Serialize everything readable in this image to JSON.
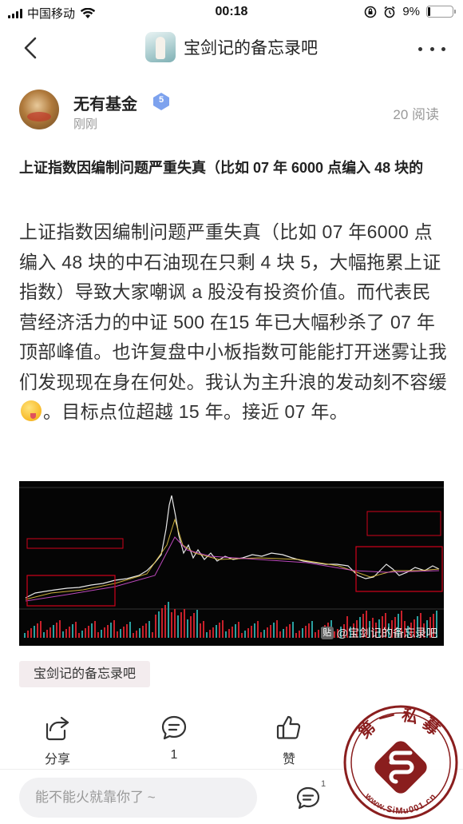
{
  "status_bar": {
    "carrier": "中国移动",
    "time": "00:18",
    "battery": "9%",
    "battery_level": 0.09
  },
  "nav": {
    "forum_name": "宝剑记的备忘录吧"
  },
  "author": {
    "name": "无有基金",
    "level": "5",
    "time": "刚刚",
    "read_count": "20 阅读"
  },
  "post": {
    "title": "上证指数因编制问题严重失真（比如 07 年 6000 点编入 48 块的",
    "body_part1": "上证指数因编制问题严重失真（比如 07 年6000 点编入 48 块的中石油现在只剩 4 块 5，大幅拖累上证指数）导致大家嘲讽 a 股没有投资价值。而代表民营经济活力的中证 500 在15 年已大幅秒杀了 07 年顶部峰值。也许复盘中小板指数可能能打开迷雾让我们发现现在身在何处。我认为主升浪的发动刻不容缓",
    "body_part2": "。目标点位超越 15 年。接近 07 年。",
    "emoji": "yum-face-emoji"
  },
  "image": {
    "watermark": "@宝剑记的备忘录吧"
  },
  "tag": {
    "label": "宝剑记的备忘录吧"
  },
  "actions": {
    "share_label": "分享",
    "comment_count": "1",
    "like_label": "赞"
  },
  "bottom": {
    "placeholder": "能不能火就靠你了 ~",
    "reply_badge": "1"
  },
  "stamp": {
    "top_text": "第一私募",
    "bottom_text": "www.SiMu001.cn"
  },
  "colors": {
    "accent_red": "#d0021b",
    "badge_blue": "#6f95e8",
    "chart_line": "#ffffff"
  }
}
